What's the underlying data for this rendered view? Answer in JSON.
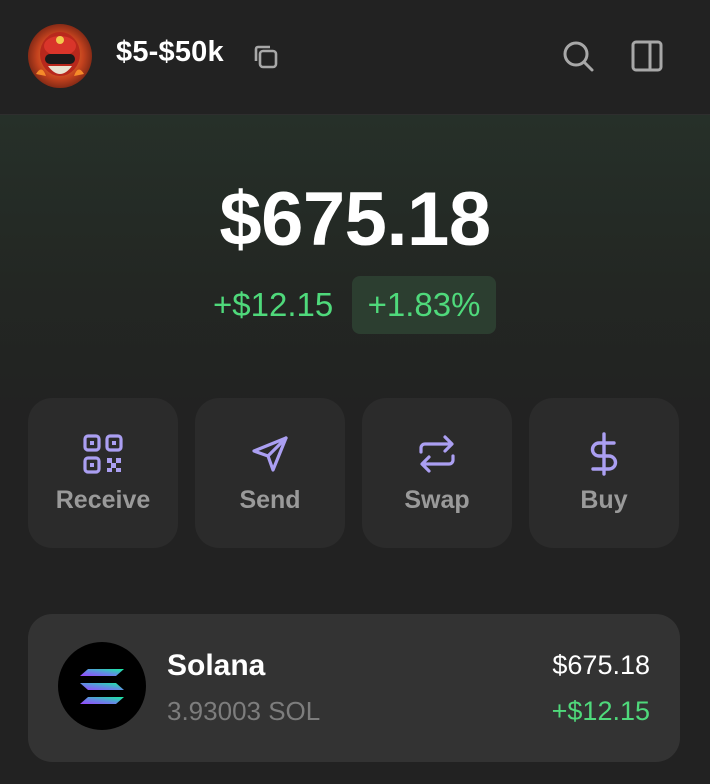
{
  "header": {
    "account_name": "$5-$50k",
    "avatar_icon": "avatar-icon",
    "copy_icon": "copy-icon",
    "search_icon": "search-icon",
    "panel_icon": "sidebar-panel-icon"
  },
  "balance": {
    "total": "$675.18",
    "change_amount": "+$12.15",
    "change_percent": "+1.83%"
  },
  "actions": [
    {
      "label": "Receive",
      "icon": "qr-code-icon"
    },
    {
      "label": "Send",
      "icon": "send-icon"
    },
    {
      "label": "Swap",
      "icon": "swap-icon"
    },
    {
      "label": "Buy",
      "icon": "dollar-icon"
    }
  ],
  "tokens": [
    {
      "name": "Solana",
      "amount": "3.93003 SOL",
      "value": "$675.18",
      "change": "+$12.15",
      "icon": "solana-logo-icon"
    }
  ],
  "colors": {
    "background": "#222222",
    "accent": "#ab9ff2",
    "positive": "#4fd97b",
    "card": "#2b2b2b"
  }
}
